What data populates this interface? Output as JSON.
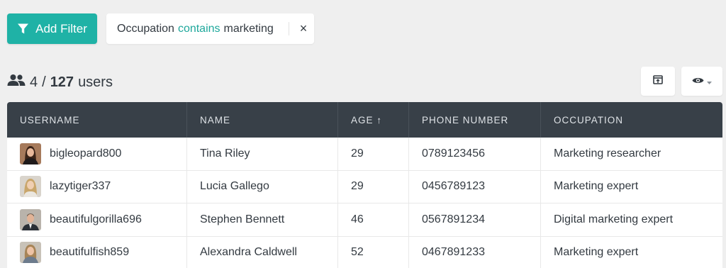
{
  "toolbar": {
    "add_filter_label": "Add Filter",
    "brand_color": "#1fb2a6"
  },
  "filter": {
    "field": "Occupation",
    "operator": "contains",
    "value": "marketing",
    "remove_icon": "×"
  },
  "summary": {
    "shown": "4",
    "separator": "/",
    "total": "127",
    "unit": "users",
    "icon": "users-icon"
  },
  "actions": {
    "export_icon": "export-icon",
    "view_icon": "eye-icon"
  },
  "table": {
    "columns": [
      "USERNAME",
      "NAME",
      "AGE ↑",
      "PHONE NUMBER",
      "OCCUPATION"
    ],
    "sort": {
      "column": "AGE",
      "direction": "ascending"
    },
    "rows": [
      {
        "username": "bigleopard800",
        "name": "Tina Riley",
        "age": "29",
        "phone": "0789123456",
        "occupation": "Marketing researcher"
      },
      {
        "username": "lazytiger337",
        "name": "Lucia Gallego",
        "age": "29",
        "phone": "0456789123",
        "occupation": "Marketing expert"
      },
      {
        "username": "beautifulgorilla696",
        "name": "Stephen Bennett",
        "age": "46",
        "phone": "0567891234",
        "occupation": "Digital marketing expert"
      },
      {
        "username": "beautifulfish859",
        "name": "Alexandra Caldwell",
        "age": "52",
        "phone": "0467891233",
        "occupation": "Marketing expert"
      }
    ]
  }
}
